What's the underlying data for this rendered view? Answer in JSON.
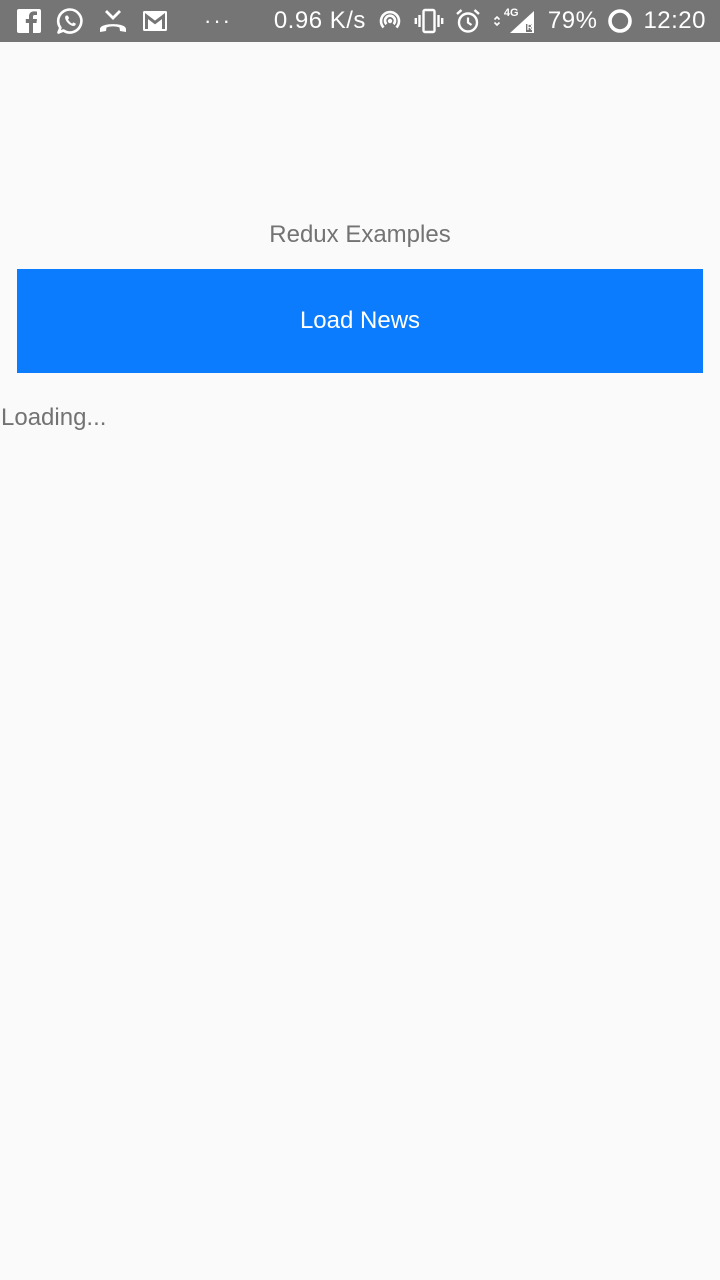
{
  "status_bar": {
    "net_speed": "0.96 K/s",
    "battery": "79%",
    "time": "12:20",
    "network_label": "4G",
    "roaming_label": "R",
    "overflow_dots": "···",
    "background_color": "#757575",
    "icons": [
      "facebook-icon",
      "whatsapp-icon",
      "missed-call-icon",
      "gmail-icon",
      "hotspot-icon",
      "vibrate-icon",
      "alarm-icon",
      "data-arrows-icon",
      "signal-icon",
      "battery-ring-icon"
    ]
  },
  "app": {
    "title": "Redux Examples",
    "load_button_label": "Load News",
    "loading_text": "Loading...",
    "accent_color": "#0c7cff",
    "background_color": "#fafafa",
    "text_color": "#737373"
  }
}
